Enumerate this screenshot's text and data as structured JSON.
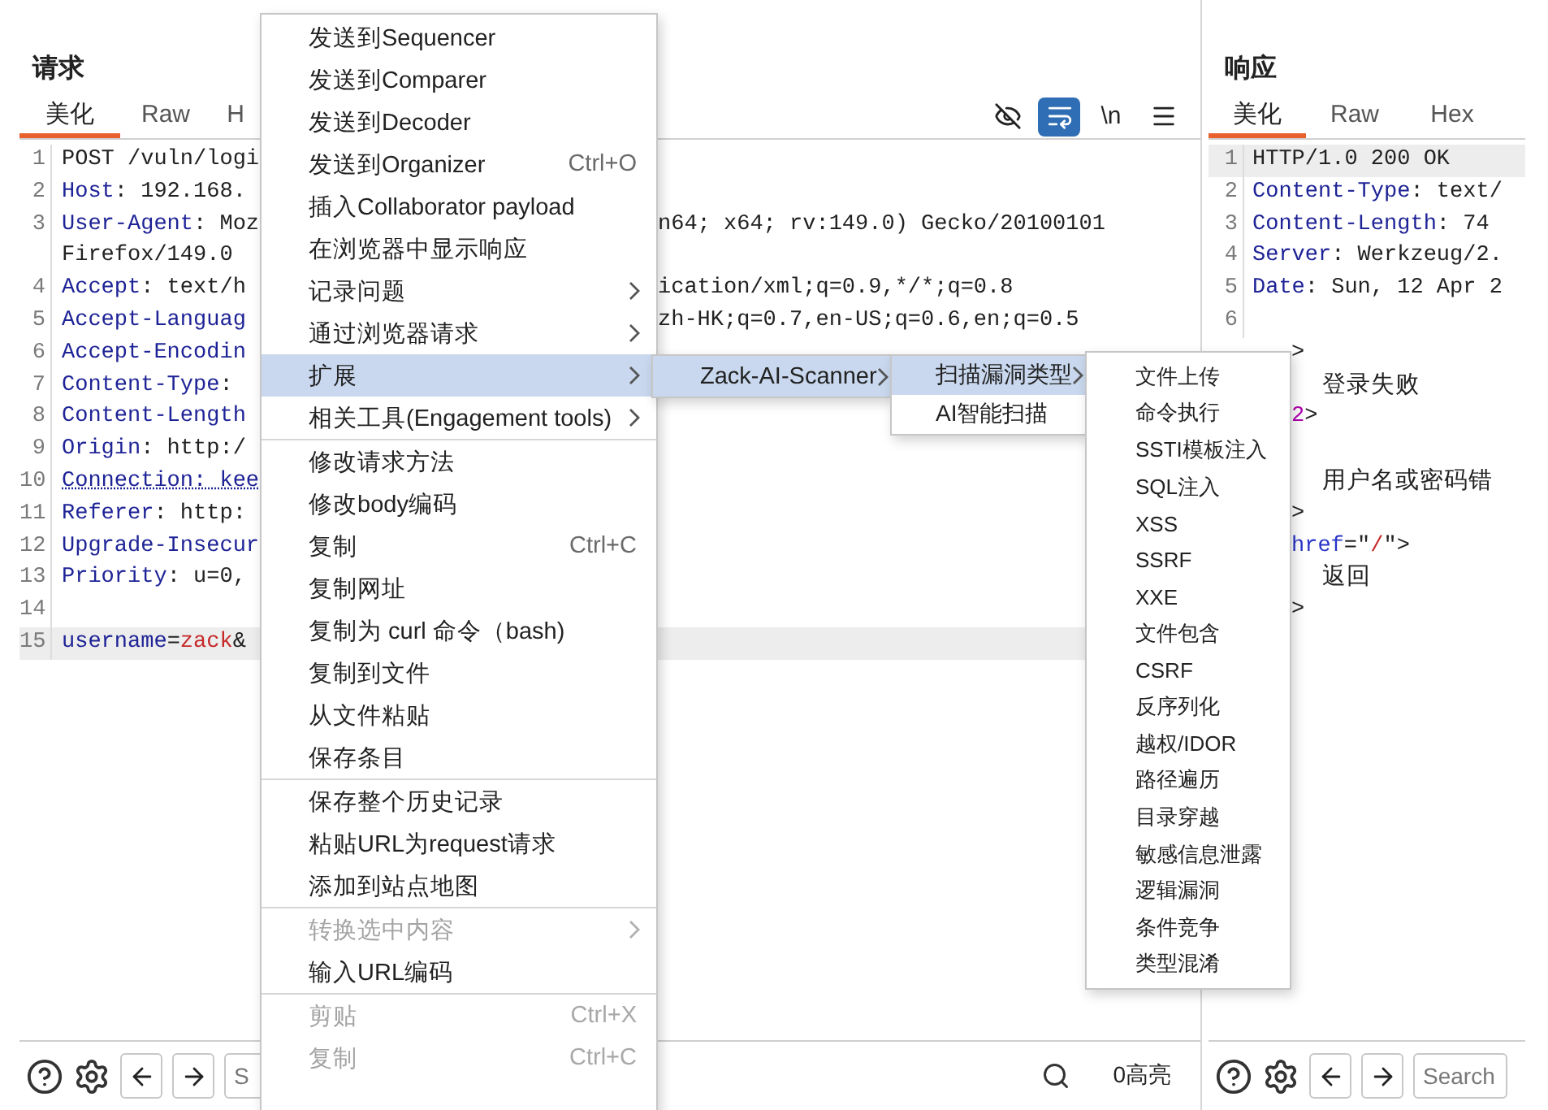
{
  "request": {
    "title": "请求",
    "tabs": [
      {
        "label": "美化",
        "selected": true
      },
      {
        "label": "Raw",
        "selected": false
      },
      {
        "label": "H",
        "selected": false
      }
    ],
    "toolbar": [
      {
        "kind": "hide",
        "selected": false
      },
      {
        "kind": "wrap",
        "selected": true
      },
      {
        "kind": "newline",
        "label": "\\n",
        "selected": false
      },
      {
        "kind": "menu",
        "selected": false
      }
    ],
    "lines": [
      {
        "num": "1",
        "left": [
          {
            "t": "POST /vuln/logi",
            "kind": "plain"
          }
        ],
        "current": false
      },
      {
        "num": "2",
        "left": [
          {
            "t": "Host",
            "kind": "name"
          },
          {
            "t": ": 192.168.",
            "kind": "plain"
          }
        ],
        "current": false
      },
      {
        "num": "3",
        "left": [
          {
            "t": "User-Agent",
            "kind": "name"
          },
          {
            "t": ": Moz",
            "kind": "plain"
          }
        ],
        "right": [
          {
            "t": "n64; x64; rv:149.0) Gecko/20100101",
            "kind": "plain"
          }
        ],
        "current": false
      },
      {
        "left": [
          {
            "t": "Firefox/149.0",
            "kind": "plain"
          }
        ],
        "current": false
      },
      {
        "num": "4",
        "left": [
          {
            "t": "Accept",
            "kind": "name"
          },
          {
            "t": ": text/h",
            "kind": "plain"
          }
        ],
        "right": [
          {
            "t": "ication/xml;q=0.9,*/*;q=0.8",
            "kind": "plain"
          }
        ],
        "current": false
      },
      {
        "num": "5",
        "left": [
          {
            "t": "Accept-Languag",
            "kind": "name"
          }
        ],
        "right": [
          {
            "t": "zh-HK;q=0.7,en-US;q=0.6,en;q=0.5",
            "kind": "plain"
          }
        ],
        "current": false
      },
      {
        "num": "6",
        "left": [
          {
            "t": "Accept-Encodin",
            "kind": "name"
          }
        ],
        "current": false
      },
      {
        "num": "7",
        "left": [
          {
            "t": "Content-Type",
            "kind": "name"
          },
          {
            "t": ":",
            "kind": "plain"
          }
        ],
        "current": false
      },
      {
        "num": "8",
        "left": [
          {
            "t": "Content-Length",
            "kind": "name"
          }
        ],
        "current": false
      },
      {
        "num": "9",
        "left": [
          {
            "t": "Origin",
            "kind": "name"
          },
          {
            "t": ": http:/",
            "kind": "plain"
          }
        ],
        "current": false
      },
      {
        "num": "10",
        "left": [
          {
            "t": "Connection: kee",
            "kind": "flagged"
          }
        ],
        "current": false
      },
      {
        "num": "11",
        "left": [
          {
            "t": "Referer",
            "kind": "name"
          },
          {
            "t": ": http:",
            "kind": "plain"
          }
        ],
        "current": false
      },
      {
        "num": "12",
        "left": [
          {
            "t": "Upgrade-Insecur",
            "kind": "name"
          }
        ],
        "current": false
      },
      {
        "num": "13",
        "left": [
          {
            "t": "Priority",
            "kind": "name"
          },
          {
            "t": ": u=0,",
            "kind": "plain"
          }
        ],
        "current": false
      },
      {
        "num": "14",
        "current": false
      },
      {
        "num": "15",
        "left": [
          {
            "t": "username",
            "kind": "name"
          },
          {
            "t": "=",
            "kind": "plain"
          },
          {
            "t": "zack",
            "kind": "value"
          },
          {
            "t": "&",
            "kind": "plain"
          }
        ],
        "current": true
      }
    ],
    "footer": {
      "search_placeholder": "S",
      "highlights": "0高亮"
    }
  },
  "response": {
    "title": "响应",
    "tabs": [
      {
        "label": "美化",
        "selected": true
      },
      {
        "label": "Raw",
        "selected": false
      },
      {
        "label": "Hex",
        "selected": false
      }
    ],
    "lines": [
      {
        "kind": "numbered",
        "num": "1",
        "parts": [
          {
            "t": "HTTP/1.0 200 OK",
            "kind": "plain"
          }
        ],
        "current": true
      },
      {
        "kind": "numbered",
        "num": "2",
        "parts": [
          {
            "t": "Content-Type",
            "kind": "name"
          },
          {
            "t": ": text/",
            "kind": "plain"
          }
        ],
        "current": false
      },
      {
        "kind": "numbered",
        "num": "3",
        "parts": [
          {
            "t": "Content-Length",
            "kind": "name"
          },
          {
            "t": ": 74",
            "kind": "plain"
          }
        ],
        "current": false
      },
      {
        "kind": "numbered",
        "num": "4",
        "parts": [
          {
            "t": "Server",
            "kind": "name"
          },
          {
            "t": ": Werkzeug/2.",
            "kind": "plain"
          }
        ],
        "current": false
      },
      {
        "kind": "numbered",
        "num": "5",
        "parts": [
          {
            "t": "Date",
            "kind": "name"
          },
          {
            "t": ": Sun, 12 Apr 2",
            "kind": "plain"
          }
        ],
        "current": false
      },
      {
        "kind": "numbered",
        "num": "6",
        "current": false
      },
      {
        "kind": "covered-tag",
        "parts": [
          {
            "t": ">",
            "kind": "plain"
          }
        ],
        "current": false
      },
      {
        "kind": "covered-text",
        "parts": [
          {
            "t": "登录失败",
            "kind": "plain"
          }
        ],
        "current": false
      },
      {
        "kind": "covered-tag",
        "parts": [
          {
            "t": "2",
            "kind": "tag"
          },
          {
            "t": ">",
            "kind": "plain"
          }
        ],
        "current": false
      },
      {
        "kind": "covered-tag",
        "current": false
      },
      {
        "kind": "covered-text",
        "parts": [
          {
            "t": "用户名或密码错",
            "kind": "plain"
          }
        ],
        "current": false
      },
      {
        "kind": "covered-tag",
        "parts": [
          {
            "t": ">",
            "kind": "plain"
          }
        ],
        "current": false
      },
      {
        "kind": "covered-tag",
        "parts": [
          {
            "t": "href",
            "kind": "attr"
          },
          {
            "t": "=\"",
            "kind": "plain"
          },
          {
            "t": "/",
            "kind": "value"
          },
          {
            "t": "\">",
            "kind": "plain"
          }
        ],
        "current": false
      },
      {
        "kind": "covered-text",
        "parts": [
          {
            "t": "返回",
            "kind": "plain"
          }
        ],
        "current": false
      },
      {
        "kind": "covered-tag",
        "parts": [
          {
            "t": ">",
            "kind": "plain"
          }
        ],
        "current": false
      }
    ],
    "footer": {
      "search_placeholder": "Search"
    }
  },
  "context_menu": {
    "items": [
      {
        "kind": "item",
        "label": "发送到Sequencer",
        "submenu": false,
        "disabled": false,
        "selected": false
      },
      {
        "kind": "item",
        "label": "发送到Comparer",
        "submenu": false,
        "disabled": false,
        "selected": false
      },
      {
        "kind": "item",
        "label": "发送到Decoder",
        "submenu": false,
        "disabled": false,
        "selected": false
      },
      {
        "kind": "item",
        "label": "发送到Organizer",
        "shortcut": "Ctrl+O",
        "submenu": false,
        "disabled": false,
        "selected": false
      },
      {
        "kind": "item",
        "label": "插入Collaborator payload",
        "submenu": false,
        "disabled": false,
        "selected": false
      },
      {
        "kind": "item",
        "label": "在浏览器中显示响应",
        "submenu": false,
        "disabled": false,
        "selected": false
      },
      {
        "kind": "item",
        "label": "记录问题",
        "submenu": true,
        "disabled": false,
        "selected": false
      },
      {
        "kind": "item",
        "label": "通过浏览器请求",
        "submenu": true,
        "disabled": false,
        "selected": false
      },
      {
        "kind": "item",
        "label": "扩展",
        "submenu": true,
        "disabled": false,
        "selected": true
      },
      {
        "kind": "item",
        "label": "相关工具(Engagement tools)",
        "submenu": true,
        "disabled": false,
        "selected": false
      },
      {
        "kind": "separator"
      },
      {
        "kind": "item",
        "label": "修改请求方法",
        "submenu": false,
        "disabled": false,
        "selected": false
      },
      {
        "kind": "item",
        "label": "修改body编码",
        "submenu": false,
        "disabled": false,
        "selected": false
      },
      {
        "kind": "item",
        "label": "复制",
        "shortcut": "Ctrl+C",
        "submenu": false,
        "disabled": false,
        "selected": false
      },
      {
        "kind": "item",
        "label": "复制网址",
        "submenu": false,
        "disabled": false,
        "selected": false
      },
      {
        "kind": "item",
        "label": "复制为 curl 命令（bash)",
        "submenu": false,
        "disabled": false,
        "selected": false
      },
      {
        "kind": "item",
        "label": "复制到文件",
        "submenu": false,
        "disabled": false,
        "selected": false
      },
      {
        "kind": "item",
        "label": "从文件粘贴",
        "submenu": false,
        "disabled": false,
        "selected": false
      },
      {
        "kind": "item",
        "label": "保存条目",
        "submenu": false,
        "disabled": false,
        "selected": false
      },
      {
        "kind": "separator"
      },
      {
        "kind": "item",
        "label": "保存整个历史记录",
        "submenu": false,
        "disabled": false,
        "selected": false
      },
      {
        "kind": "item",
        "label": "粘贴URL为request请求",
        "submenu": false,
        "disabled": false,
        "selected": false
      },
      {
        "kind": "item",
        "label": "添加到站点地图",
        "submenu": false,
        "disabled": false,
        "selected": false
      },
      {
        "kind": "separator"
      },
      {
        "kind": "item",
        "label": "转换选中内容",
        "submenu": true,
        "disabled": true,
        "selected": false
      },
      {
        "kind": "item",
        "label": "输入URL编码",
        "submenu": false,
        "disabled": false,
        "selected": false
      },
      {
        "kind": "separator"
      },
      {
        "kind": "item",
        "label": "剪贴",
        "shortcut": "Ctrl+X",
        "submenu": false,
        "disabled": true,
        "selected": false
      },
      {
        "kind": "item",
        "label": "复制",
        "shortcut": "Ctrl+C",
        "submenu": false,
        "disabled": true,
        "selected": false
      }
    ]
  },
  "submenus": [
    {
      "items": [
        {
          "kind": "item",
          "label": "Zack-AI-Scanner",
          "submenu": true,
          "disabled": false,
          "selected": true
        }
      ]
    },
    {
      "items": [
        {
          "kind": "item",
          "label": "扫描漏洞类型",
          "submenu": true,
          "disabled": false,
          "selected": true
        },
        {
          "kind": "item",
          "label": "AI智能扫描",
          "submenu": false,
          "disabled": false,
          "selected": false
        }
      ]
    },
    {
      "items": [
        {
          "kind": "item",
          "label": "文件上传",
          "submenu": false,
          "disabled": false,
          "selected": false
        },
        {
          "kind": "item",
          "label": "命令执行",
          "submenu": false,
          "disabled": false,
          "selected": false
        },
        {
          "kind": "item",
          "label": "SSTI模板注入",
          "submenu": false,
          "disabled": false,
          "selected": false
        },
        {
          "kind": "item",
          "label": "SQL注入",
          "submenu": false,
          "disabled": false,
          "selected": false
        },
        {
          "kind": "item",
          "label": "XSS",
          "submenu": false,
          "disabled": false,
          "selected": false
        },
        {
          "kind": "item",
          "label": "SSRF",
          "submenu": false,
          "disabled": false,
          "selected": false
        },
        {
          "kind": "item",
          "label": "XXE",
          "submenu": false,
          "disabled": false,
          "selected": false
        },
        {
          "kind": "item",
          "label": "文件包含",
          "submenu": false,
          "disabled": false,
          "selected": false
        },
        {
          "kind": "item",
          "label": "CSRF",
          "submenu": false,
          "disabled": false,
          "selected": false
        },
        {
          "kind": "item",
          "label": "反序列化",
          "submenu": false,
          "disabled": false,
          "selected": false
        },
        {
          "kind": "item",
          "label": "越权/IDOR",
          "submenu": false,
          "disabled": false,
          "selected": false
        },
        {
          "kind": "item",
          "label": "路径遍历",
          "submenu": false,
          "disabled": false,
          "selected": false
        },
        {
          "kind": "item",
          "label": "目录穿越",
          "submenu": false,
          "disabled": false,
          "selected": false
        },
        {
          "kind": "item",
          "label": "敏感信息泄露",
          "submenu": false,
          "disabled": false,
          "selected": false
        },
        {
          "kind": "item",
          "label": "逻辑漏洞",
          "submenu": false,
          "disabled": false,
          "selected": false
        },
        {
          "kind": "item",
          "label": "条件竞争",
          "submenu": false,
          "disabled": false,
          "selected": false
        },
        {
          "kind": "item",
          "label": "类型混淆",
          "submenu": false,
          "disabled": false,
          "selected": false
        }
      ]
    }
  ]
}
